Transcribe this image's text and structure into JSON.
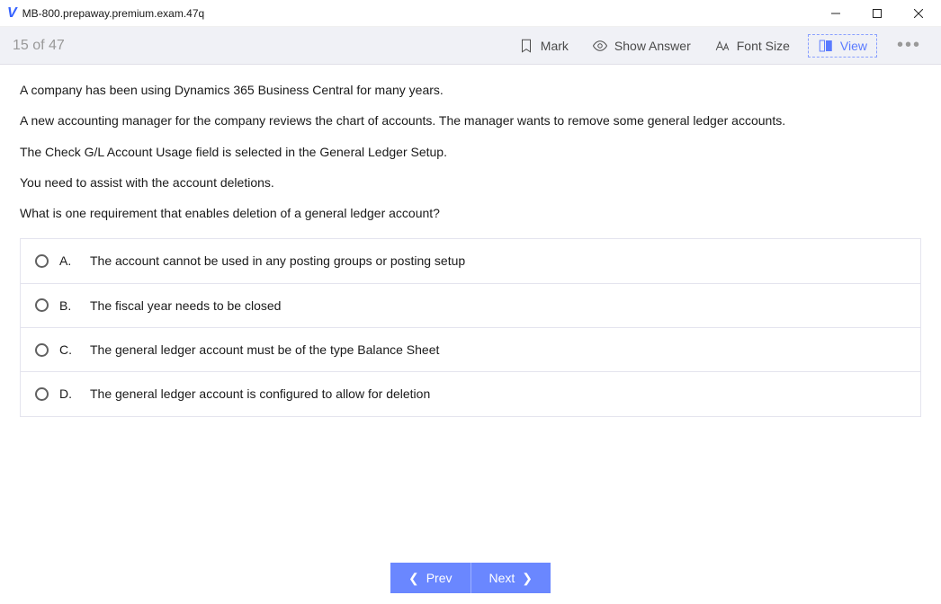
{
  "window": {
    "title": "MB-800.prepaway.premium.exam.47q"
  },
  "toolbar": {
    "counter": "15 of 47",
    "mark_label": "Mark",
    "show_answer_label": "Show Answer",
    "font_size_label": "Font Size",
    "view_label": "View"
  },
  "question": {
    "paragraphs": [
      "A company has been using Dynamics 365 Business Central for many years.",
      "A new accounting manager for the company reviews the chart of accounts. The manager wants to remove some general ledger accounts.",
      "The Check G/L Account Usage field is selected in the General Ledger Setup.",
      "You need to assist with the account deletions.",
      "What is one requirement that enables deletion of a general ledger account?"
    ],
    "options": [
      {
        "letter": "A.",
        "text": "The account cannot be used in any posting groups or posting setup"
      },
      {
        "letter": "B.",
        "text": "The fiscal year needs to be closed"
      },
      {
        "letter": "C.",
        "text": "The general ledger account must be of the type Balance Sheet"
      },
      {
        "letter": "D.",
        "text": "The general ledger account is configured to allow for deletion"
      }
    ]
  },
  "footer": {
    "prev_label": "Prev",
    "next_label": "Next"
  }
}
